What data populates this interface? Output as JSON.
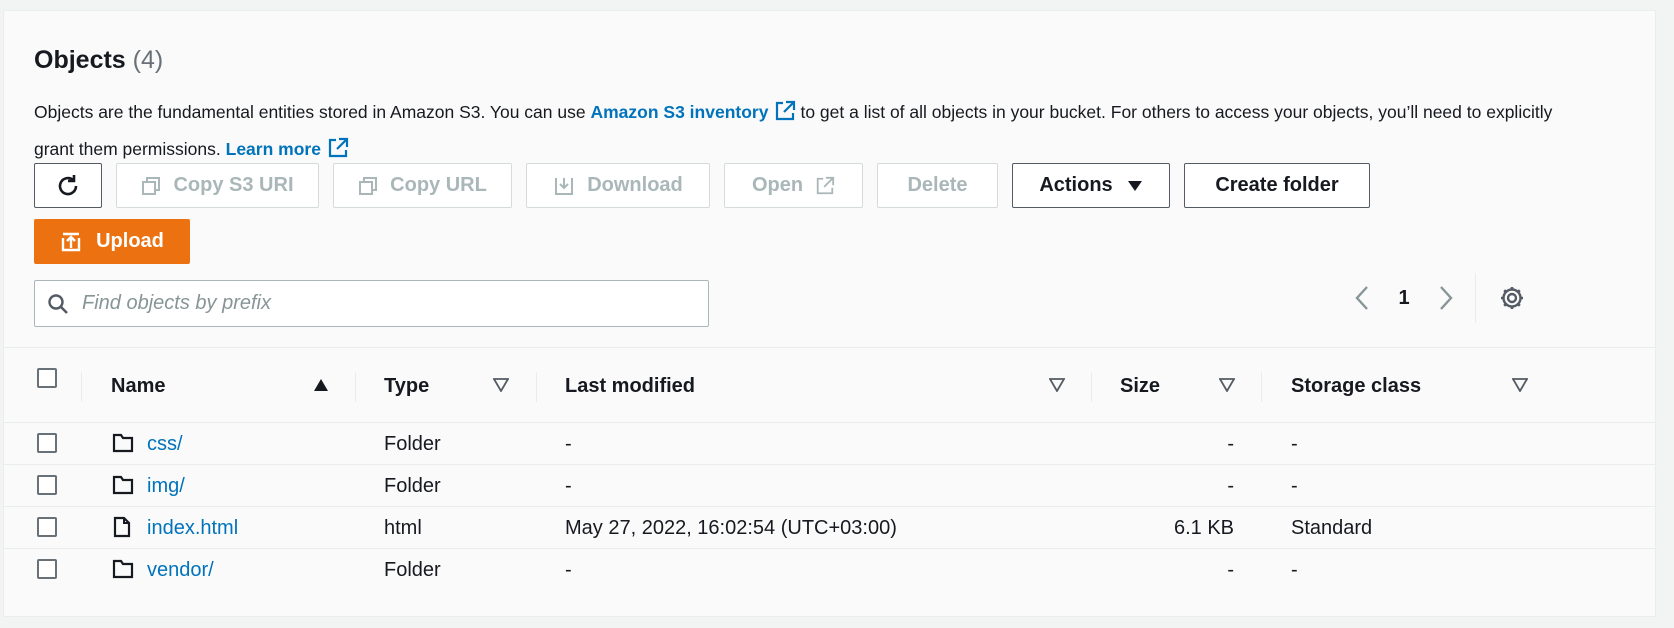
{
  "header": {
    "title": "Objects",
    "count": "(4)"
  },
  "description": {
    "part1": "Objects are the fundamental entities stored in Amazon S3. You can use",
    "inventory_link": "Amazon S3 inventory",
    "part2": "to get a list of all objects in your bucket. For others to access your objects, you’ll need to explicitly grant them permissions.",
    "learn_more": "Learn more"
  },
  "toolbar": {
    "copy_s3_uri": "Copy S3 URI",
    "copy_url": "Copy URL",
    "download": "Download",
    "open": "Open",
    "delete": "Delete",
    "actions": "Actions",
    "create_folder": "Create folder",
    "upload": "Upload"
  },
  "search": {
    "placeholder": "Find objects by prefix",
    "value": ""
  },
  "pagination": {
    "current_page": "1"
  },
  "table": {
    "columns": [
      "Name",
      "Type",
      "Last modified",
      "Size",
      "Storage class"
    ],
    "rows": [
      {
        "name": "css/",
        "type": "Folder",
        "last_modified": "-",
        "size": "-",
        "storage_class": "-",
        "icon": "folder-icon"
      },
      {
        "name": "img/",
        "type": "Folder",
        "last_modified": "-",
        "size": "-",
        "storage_class": "-",
        "icon": "folder-icon"
      },
      {
        "name": "index.html",
        "type": "html",
        "last_modified": "May 27, 2022, 16:02:54 (UTC+03:00)",
        "size": "6.1 KB",
        "storage_class": "Standard",
        "icon": "file-icon"
      },
      {
        "name": "vendor/",
        "type": "Folder",
        "last_modified": "-",
        "size": "-",
        "storage_class": "-",
        "icon": "folder-icon"
      }
    ]
  },
  "colors": {
    "link": "#0073bb",
    "primary": "#ec7211",
    "disabled": "#aab7b8"
  }
}
